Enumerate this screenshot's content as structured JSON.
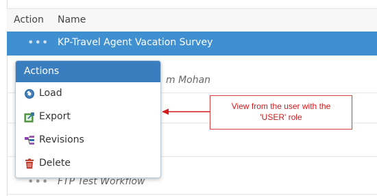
{
  "table": {
    "col_action": "Action",
    "col_name": "Name",
    "rows": [
      {
        "dots": "•••",
        "name": "KP-Travel Agent Vacation Survey"
      },
      {
        "dots": "•••",
        "name": "m Mohan"
      },
      {
        "dots": "•••",
        "name": ""
      },
      {
        "dots": "•••",
        "name": ""
      },
      {
        "dots": "•••",
        "name": "FTP Test Workflow"
      }
    ]
  },
  "menu": {
    "title": "Actions",
    "items": [
      {
        "label": "Load",
        "icon": "load-icon"
      },
      {
        "label": "Export",
        "icon": "export-icon"
      },
      {
        "label": "Revisions",
        "icon": "revisions-icon"
      },
      {
        "label": "Delete",
        "icon": "trash-icon"
      }
    ]
  },
  "annotation": {
    "line1": "View from the user with the",
    "line2": "'USER' role"
  },
  "colors": {
    "selected_row": "#3f8fd1",
    "menu_header": "#3a7ec0",
    "annotation": "#d11a1a"
  }
}
